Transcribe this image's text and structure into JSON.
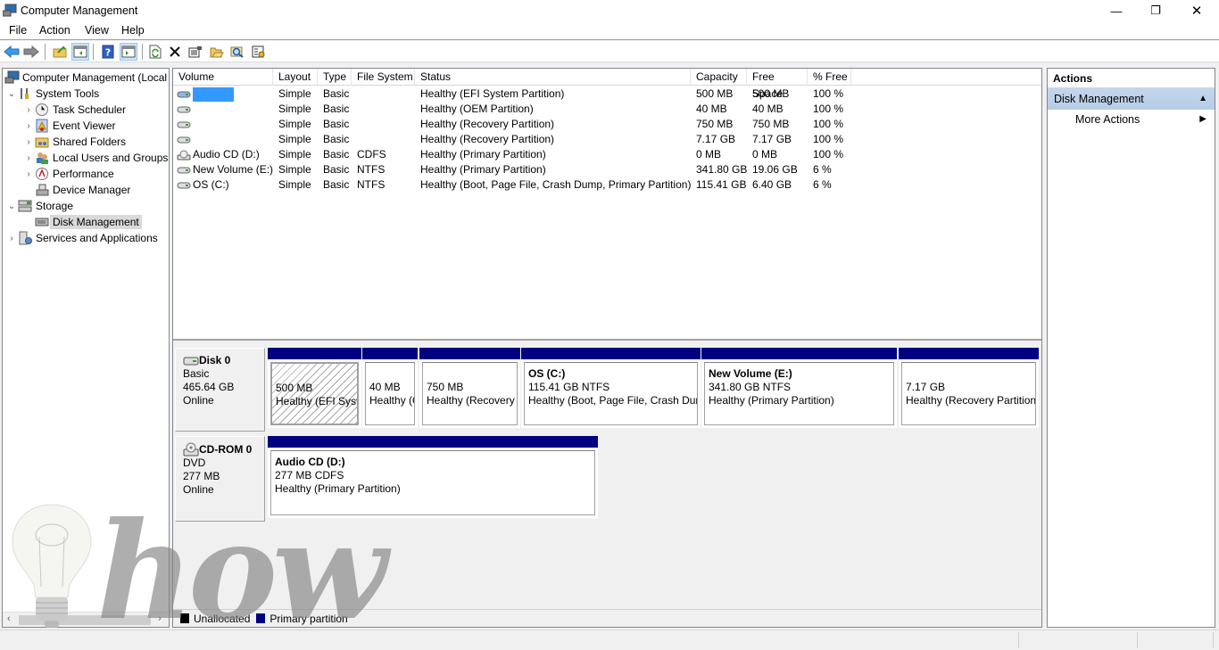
{
  "window": {
    "title": "Computer Management",
    "controls": {
      "minimize": "—",
      "restore": "❐",
      "close": "✕"
    }
  },
  "menu": [
    "File",
    "Action",
    "View",
    "Help"
  ],
  "toolbar": [
    {
      "name": "back-icon"
    },
    {
      "name": "forward-icon"
    },
    {
      "name": "up-folder-icon"
    },
    {
      "name": "show-hide-tree-icon"
    },
    {
      "name": "help-icon"
    },
    {
      "name": "show-hide-action-pane-icon"
    },
    {
      "name": "refresh-icon"
    },
    {
      "name": "delete-icon"
    },
    {
      "name": "properties-icon"
    },
    {
      "name": "open-icon"
    },
    {
      "name": "search-icon"
    },
    {
      "name": "settings-icon"
    }
  ],
  "tree": {
    "root": "Computer Management (Local",
    "items": [
      {
        "label": "System Tools",
        "level": 1,
        "expanded": true
      },
      {
        "label": "Task Scheduler",
        "level": 2
      },
      {
        "label": "Event Viewer",
        "level": 2
      },
      {
        "label": "Shared Folders",
        "level": 2
      },
      {
        "label": "Local Users and Groups",
        "level": 2
      },
      {
        "label": "Performance",
        "level": 2
      },
      {
        "label": "Device Manager",
        "level": 2
      },
      {
        "label": "Storage",
        "level": 1,
        "expanded": true
      },
      {
        "label": "Disk Management",
        "level": 2,
        "selected": true
      },
      {
        "label": "Services and Applications",
        "level": 1
      }
    ]
  },
  "volumes": {
    "columns": [
      "Volume",
      "Layout",
      "Type",
      "File System",
      "Status",
      "Capacity",
      "Free Space",
      "% Free"
    ],
    "rows": [
      {
        "volume": "",
        "layout": "Simple",
        "type": "Basic",
        "fs": "",
        "status": "Healthy (EFI System Partition)",
        "capacity": "500 MB",
        "free": "500 MB",
        "pct": "100 %",
        "selected": true
      },
      {
        "volume": "",
        "layout": "Simple",
        "type": "Basic",
        "fs": "",
        "status": "Healthy (OEM Partition)",
        "capacity": "40 MB",
        "free": "40 MB",
        "pct": "100 %"
      },
      {
        "volume": "",
        "layout": "Simple",
        "type": "Basic",
        "fs": "",
        "status": "Healthy (Recovery Partition)",
        "capacity": "750 MB",
        "free": "750 MB",
        "pct": "100 %"
      },
      {
        "volume": "",
        "layout": "Simple",
        "type": "Basic",
        "fs": "",
        "status": "Healthy (Recovery Partition)",
        "capacity": "7.17 GB",
        "free": "7.17 GB",
        "pct": "100 %"
      },
      {
        "volume": "Audio CD (D:)",
        "layout": "Simple",
        "type": "Basic",
        "fs": "CDFS",
        "status": "Healthy (Primary Partition)",
        "capacity": "0 MB",
        "free": "0 MB",
        "pct": "100 %"
      },
      {
        "volume": "New Volume (E:)",
        "layout": "Simple",
        "type": "Basic",
        "fs": "NTFS",
        "status": "Healthy (Primary Partition)",
        "capacity": "341.80 GB",
        "free": "19.06 GB",
        "pct": "6 %"
      },
      {
        "volume": "OS (C:)",
        "layout": "Simple",
        "type": "Basic",
        "fs": "NTFS",
        "status": "Healthy (Boot, Page File, Crash Dump, Primary Partition)",
        "capacity": "115.41 GB",
        "free": "6.40 GB",
        "pct": "6 %"
      }
    ]
  },
  "disks": [
    {
      "name": "Disk 0",
      "kind": "Basic",
      "size": "465.64 GB",
      "state": "Online",
      "partitions": [
        {
          "title": "",
          "line1": "500 MB",
          "line2": "Healthy (EFI System Partition)",
          "hatched": true
        },
        {
          "title": "",
          "line1": "40 MB",
          "line2": "Healthy (OEM Partition)"
        },
        {
          "title": "",
          "line1": "750 MB",
          "line2": "Healthy (Recovery Partition)"
        },
        {
          "title": "OS  (C:)",
          "line1": "115.41 GB NTFS",
          "line2": "Healthy (Boot, Page File, Crash Dump, Primary Partition)"
        },
        {
          "title": "New Volume  (E:)",
          "line1": "341.80 GB NTFS",
          "line2": "Healthy (Primary Partition)"
        },
        {
          "title": "",
          "line1": "7.17 GB",
          "line2": "Healthy (Recovery Partition)"
        }
      ]
    },
    {
      "name": "CD-ROM 0",
      "kind": "DVD",
      "size": "277 MB",
      "state": "Online",
      "partitions": [
        {
          "title": "Audio CD  (D:)",
          "line1": "277 MB CDFS",
          "line2": "Healthy (Primary Partition)"
        }
      ]
    }
  ],
  "legend": [
    {
      "label": "Unallocated",
      "color": "#000000"
    },
    {
      "label": "Primary partition",
      "color": "#000080"
    }
  ],
  "actions": {
    "header": "Actions",
    "group": "Disk Management",
    "items": [
      "More Actions"
    ]
  },
  "watermark": "how",
  "colors": {
    "primary_partition": "#000080",
    "selection": "#3399ff",
    "action_group": "#bcd1e9"
  }
}
